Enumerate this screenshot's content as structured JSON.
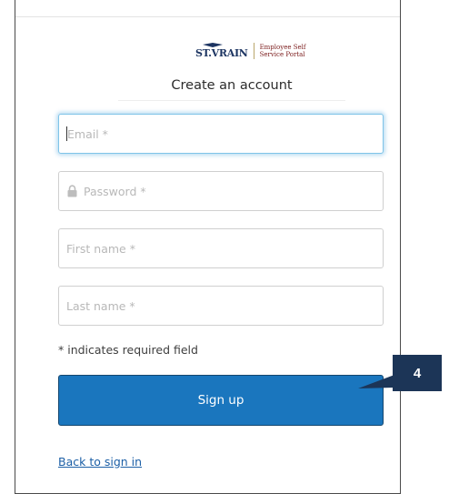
{
  "logo": {
    "mark": "ST.VRAIN",
    "text": "Employee Self\nService Portal"
  },
  "form": {
    "title": "Create an account",
    "fields": [
      {
        "name": "email",
        "placeholder": "Email *",
        "focused": true
      },
      {
        "name": "password",
        "placeholder": "Password *",
        "icon": "lock-icon"
      },
      {
        "name": "first_name",
        "placeholder": "First name *"
      },
      {
        "name": "last_name",
        "placeholder": "Last name *"
      }
    ],
    "required_note": "* indicates required field",
    "submit_label": "Sign up",
    "back_link": "Back to sign in"
  },
  "callout": {
    "number": "4"
  },
  "colors": {
    "button": "#1a76be",
    "link": "#1c5fa6",
    "callout": "#1c3557",
    "focus": "#7fc4e8"
  }
}
